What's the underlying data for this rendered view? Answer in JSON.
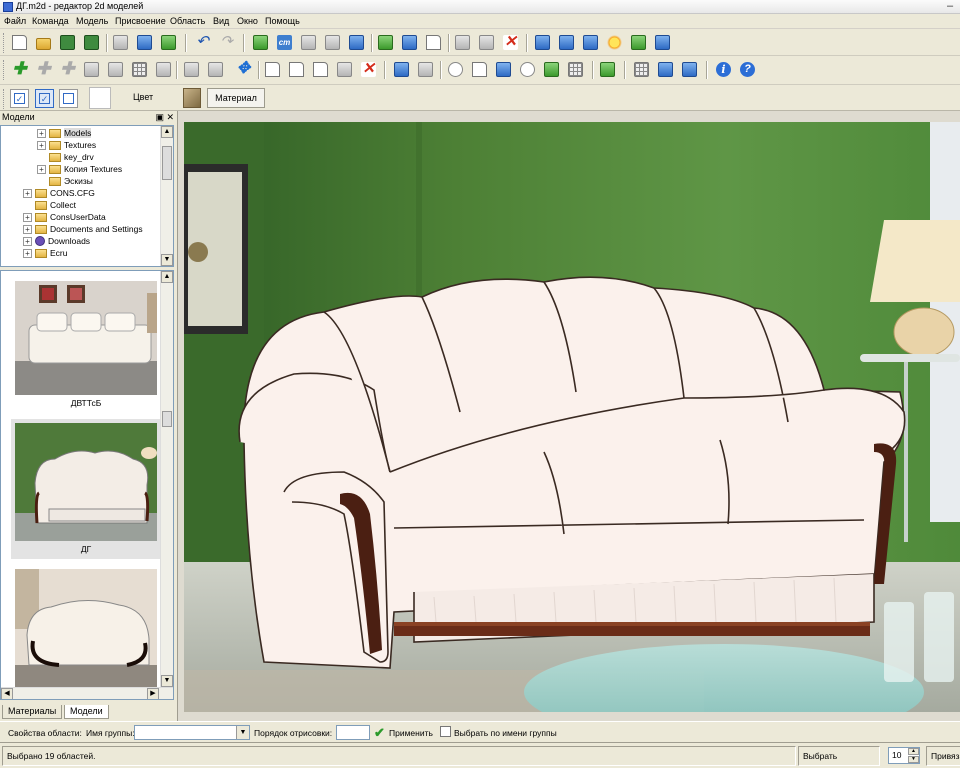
{
  "window": {
    "title": "ДГ.m2d - редактор 2d моделей"
  },
  "menu": [
    "Файл",
    "Команда",
    "Модель",
    "Присвоение",
    "Область",
    "Вид",
    "Окно",
    "Помощь"
  ],
  "toolbar3": {
    "color_label": "Цвет",
    "material_tab": "Материал"
  },
  "left_panel": {
    "title": "Модели",
    "tree": [
      {
        "label": "Models",
        "indent": 1,
        "expander": "+",
        "selected": true
      },
      {
        "label": "Textures",
        "indent": 1,
        "expander": "+"
      },
      {
        "label": "key_drv",
        "indent": 1,
        "expander": ""
      },
      {
        "label": "Копия Textures",
        "indent": 1,
        "expander": "+"
      },
      {
        "label": "Эскизы",
        "indent": 1,
        "expander": ""
      },
      {
        "label": "CONS.CFG",
        "indent": 0,
        "expander": "+"
      },
      {
        "label": "Collect",
        "indent": 0,
        "expander": ""
      },
      {
        "label": "ConsUserData",
        "indent": 0,
        "expander": "+"
      },
      {
        "label": "Documents and Settings",
        "indent": 0,
        "expander": "+"
      },
      {
        "label": "Downloads",
        "indent": 0,
        "expander": "+",
        "special": true
      },
      {
        "label": "Ecru",
        "indent": 0,
        "expander": "+"
      }
    ],
    "thumbnails": [
      {
        "caption": "ДВТТсБ",
        "selected": false
      },
      {
        "caption": "ДГ",
        "selected": true
      },
      {
        "caption": "",
        "selected": false
      }
    ],
    "tabs": [
      {
        "label": "Материалы",
        "active": false
      },
      {
        "label": "Модели",
        "active": true
      }
    ]
  },
  "bottom": {
    "area_props_label": "Свойства области:",
    "group_name_label": "Имя группы:",
    "group_name_value": "",
    "draw_order_label": "Порядок отрисовки:",
    "draw_order_value": "",
    "apply_label": "Применить",
    "select_by_group_label": "Выбрать по имени группы"
  },
  "status": {
    "selected_text": "Выбрано 19 областей.",
    "select_label": "Выбрать",
    "spin_value": "10",
    "snap_label": "Привяз"
  }
}
